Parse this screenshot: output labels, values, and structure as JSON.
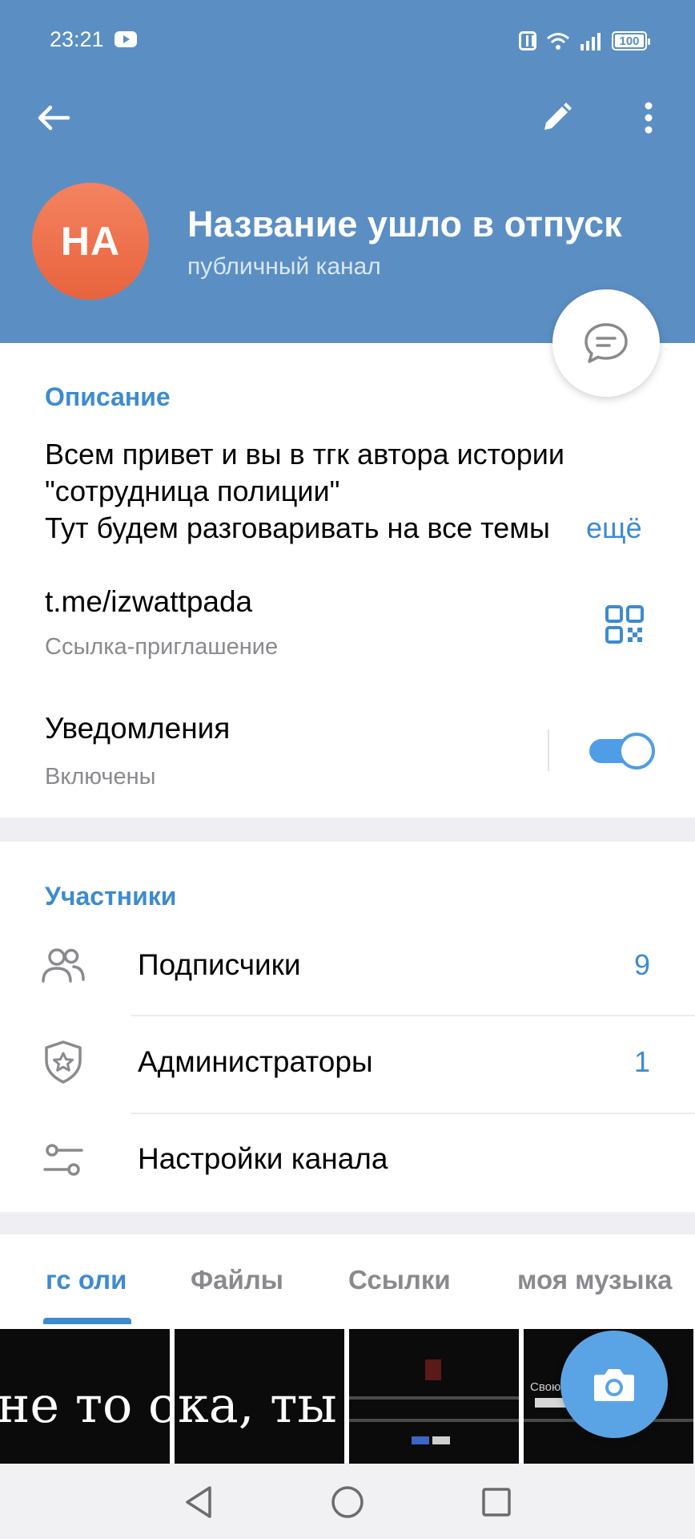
{
  "status_bar": {
    "time": "23:21",
    "battery": "100",
    "icons": [
      "youtube-icon",
      "nfc-icon",
      "wifi-icon",
      "signal-icon",
      "battery-icon"
    ]
  },
  "toolbar": {
    "back_icon": "arrow-left-icon",
    "edit_icon": "pencil-icon",
    "more_icon": "more-vertical-icon"
  },
  "channel": {
    "avatar_initials": "НА",
    "title": "Название ушло в отпуск",
    "subtitle": "публичный канал"
  },
  "info": {
    "description_title": "Описание",
    "description_text": "Всем привет и вы в тгк автора истории\n\"сотрудница полиции\"\nТут будем разговаривать на все темы",
    "more_label": "ещё",
    "link": "t.me/izwattpada",
    "link_caption": "Ссылка-приглашение",
    "notifications_title": "Уведомления",
    "notifications_status": "Включены",
    "notifications_enabled": true
  },
  "members": {
    "title": "Участники",
    "rows": [
      {
        "label": "Подписчики",
        "count": "9",
        "icon": "people-icon"
      },
      {
        "label": "Администраторы",
        "count": "1",
        "icon": "shield-star-icon"
      },
      {
        "label": "Настройки канала",
        "count": "",
        "icon": "sliders-icon"
      }
    ]
  },
  "media_tabs": [
    {
      "label": "гс оли",
      "active": true
    },
    {
      "label": "Файлы",
      "active": false
    },
    {
      "label": "Ссылки",
      "active": false
    },
    {
      "label": "моя музыка",
      "active": false
    }
  ],
  "thumbnails": [
    {
      "text": "не то с"
    },
    {
      "text": "ка, ты"
    },
    {
      "text": ""
    },
    {
      "text": "Свою"
    }
  ],
  "fabs": {
    "chat_icon": "chat-bubble-icon",
    "camera_icon": "camera-icon"
  },
  "colors": {
    "header": "#5b8fc3",
    "accent": "#3d8bd1",
    "avatar": "#ee6e48",
    "toggle": "#4f9de6",
    "camera_fab": "#5aa4e6"
  }
}
